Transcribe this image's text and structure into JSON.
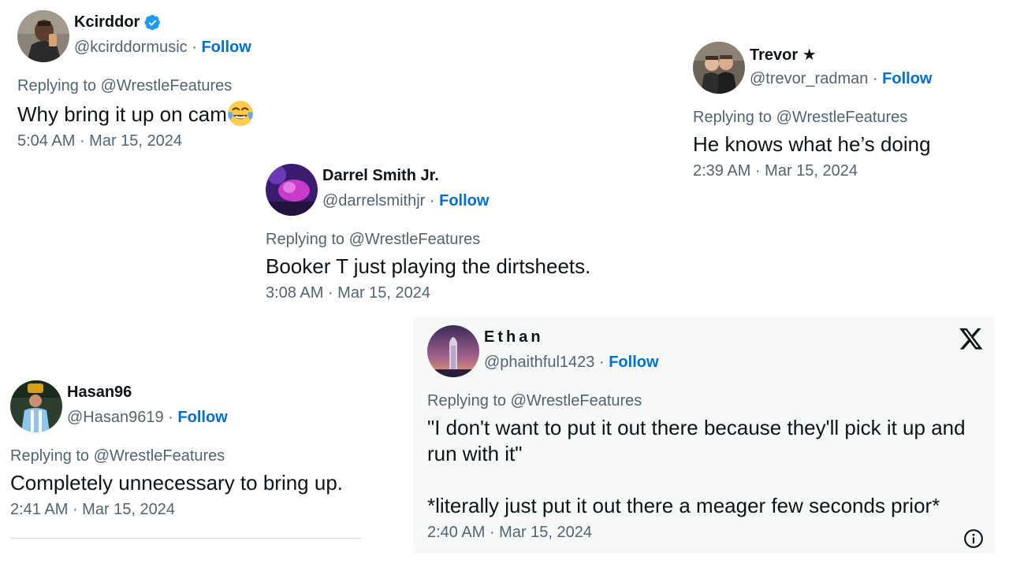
{
  "tweets": [
    {
      "name": "Kcirddor",
      "handle": "@kcirddormusic",
      "follow": "Follow",
      "reply_prefix": "Replying to ",
      "reply_to": "@WrestleFeatures",
      "text": "Why bring it up on cam",
      "emoji": "face-with-tears-of-joy",
      "time": "5:04 AM",
      "date": "Mar 15, 2024",
      "verified": true
    },
    {
      "name": "Trevor ★",
      "handle": "@trevor_radman",
      "follow": "Follow",
      "reply_prefix": "Replying to ",
      "reply_to": "@WrestleFeatures",
      "text": "He knows what he’s doing",
      "time": "2:39 AM",
      "date": "Mar 15, 2024"
    },
    {
      "name": "Darrel Smith Jr.",
      "handle": "@darrelsmithjr",
      "follow": "Follow",
      "reply_prefix": "Replying to ",
      "reply_to": "@WrestleFeatures",
      "text": "Booker T just playing the dirtsheets.",
      "time": "3:08 AM",
      "date": "Mar 15, 2024"
    },
    {
      "name": "Hasan96",
      "handle": "@Hasan9619",
      "follow": "Follow",
      "reply_prefix": "Replying to ",
      "reply_to": "@WrestleFeatures",
      "text": "Completely unnecessary to bring up.",
      "time": "2:41 AM",
      "date": "Mar 15, 2024"
    },
    {
      "name": "Ethan",
      "handle": "@phaithful1423",
      "follow": "Follow",
      "reply_prefix": "Replying to ",
      "reply_to": "@WrestleFeatures",
      "text": "\"I don't want to put it out there because they'll pick it up and run with it\"\n\n*literally just put it out there a meager few seconds prior*",
      "time": "2:40 AM",
      "date": "Mar 15, 2024"
    }
  ],
  "separator": " · ",
  "colors": {
    "follow": "#006fd6",
    "secondary_text": "#536471",
    "primary_text": "#0f1419",
    "verified": "#1d9bf0",
    "card_background": "#f7f9f9"
  },
  "icons": {
    "verified": "verified-badge-icon",
    "x_logo": "x-logo-icon",
    "info": "info-icon"
  }
}
